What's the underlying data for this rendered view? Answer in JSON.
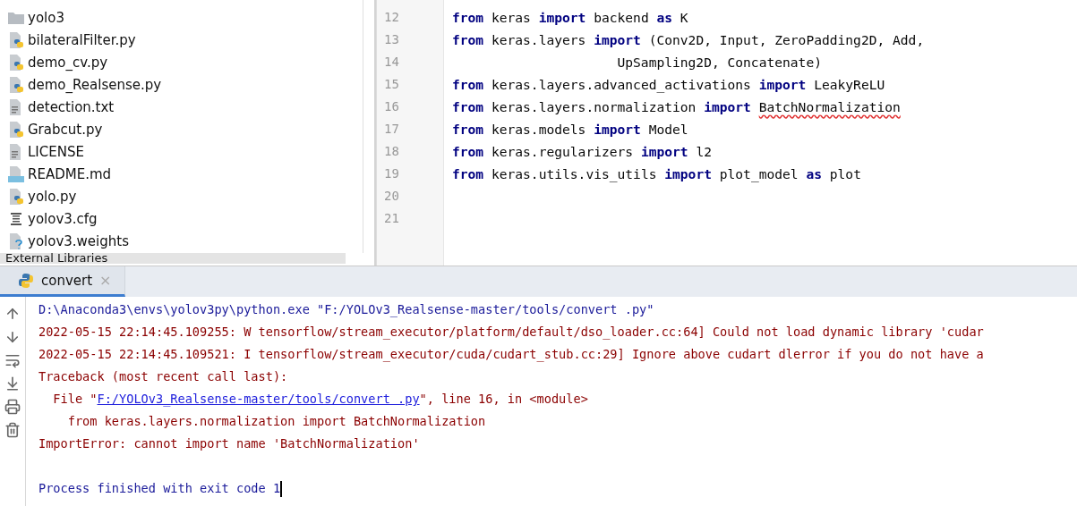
{
  "project_tree": {
    "items": [
      {
        "name": "yolo3",
        "kind": "folder"
      },
      {
        "name": "bilateralFilter.py",
        "kind": "python"
      },
      {
        "name": "demo_cv.py",
        "kind": "python"
      },
      {
        "name": "demo_Realsense.py",
        "kind": "python"
      },
      {
        "name": "detection.txt",
        "kind": "text"
      },
      {
        "name": "Grabcut.py",
        "kind": "python"
      },
      {
        "name": "LICENSE",
        "kind": "text"
      },
      {
        "name": "README.md",
        "kind": "markdown"
      },
      {
        "name": "yolo.py",
        "kind": "python"
      },
      {
        "name": "yolov3.cfg",
        "kind": "config"
      },
      {
        "name": "yolov3.weights",
        "kind": "unknown"
      }
    ],
    "footer": "External Libraries"
  },
  "editor": {
    "lines": [
      {
        "number": "12",
        "tokens": [
          {
            "text": "from",
            "kind": "keyword"
          },
          {
            "text": " keras ",
            "kind": "plain"
          },
          {
            "text": "import",
            "kind": "keyword"
          },
          {
            "text": " backend ",
            "kind": "plain"
          },
          {
            "text": "as",
            "kind": "keyword"
          },
          {
            "text": " K",
            "kind": "plain"
          }
        ]
      },
      {
        "number": "13",
        "tokens": [
          {
            "text": "from",
            "kind": "keyword"
          },
          {
            "text": " keras.layers ",
            "kind": "plain"
          },
          {
            "text": "import",
            "kind": "keyword"
          },
          {
            "text": " (Conv2D, Input, ZeroPadding2D, Add,",
            "kind": "plain"
          }
        ]
      },
      {
        "number": "14",
        "tokens": [
          {
            "text": "                     UpSampling2D, Concatenate)",
            "kind": "plain"
          }
        ]
      },
      {
        "number": "15",
        "tokens": [
          {
            "text": "from",
            "kind": "keyword"
          },
          {
            "text": " keras.layers.advanced_activations ",
            "kind": "plain"
          },
          {
            "text": "import",
            "kind": "keyword"
          },
          {
            "text": " LeakyReLU",
            "kind": "plain"
          }
        ]
      },
      {
        "number": "16",
        "tokens": [
          {
            "text": "from",
            "kind": "keyword"
          },
          {
            "text": " keras.layers.normalization ",
            "kind": "plain"
          },
          {
            "text": "import",
            "kind": "keyword"
          },
          {
            "text": "BatchNormalization",
            "kind": "warning"
          }
        ]
      },
      {
        "number": "17",
        "tokens": [
          {
            "text": "from",
            "kind": "keyword"
          },
          {
            "text": " keras.models ",
            "kind": "plain"
          },
          {
            "text": "import",
            "kind": "keyword"
          },
          {
            "text": " Model",
            "kind": "plain"
          }
        ]
      },
      {
        "number": "18",
        "tokens": [
          {
            "text": "from",
            "kind": "keyword"
          },
          {
            "text": " keras.regularizers ",
            "kind": "plain"
          },
          {
            "text": "import",
            "kind": "keyword"
          },
          {
            "text": " l2",
            "kind": "plain"
          }
        ]
      },
      {
        "number": "19",
        "tokens": [
          {
            "text": "from",
            "kind": "keyword"
          },
          {
            "text": " keras.utils.vis_utils ",
            "kind": "plain"
          },
          {
            "text": "import",
            "kind": "keyword"
          },
          {
            "text": " plot_model ",
            "kind": "plain"
          },
          {
            "text": "as",
            "kind": "keyword"
          },
          {
            "text": " plot",
            "kind": "plain"
          }
        ]
      },
      {
        "number": "20"
      },
      {
        "number": "21"
      }
    ]
  },
  "run_panel": {
    "tabs": [
      {
        "label": "convert",
        "selected": true,
        "close": "×"
      }
    ],
    "console": [
      {
        "segments": [
          {
            "text": "D:\\Anaconda3\\envs\\yolov3py\\python.exe \"F:/YOLOv3_Realsense-master/tools/convert .py\"",
            "kind": "command"
          }
        ]
      },
      {
        "segments": [
          {
            "text": "2022-05-15 22:14:45.109255: W tensorflow/stream_executor/platform/default/dso_loader.cc:64] Could not load dynamic library 'cudar",
            "kind": "error"
          }
        ]
      },
      {
        "segments": [
          {
            "text": "2022-05-15 22:14:45.109521: I tensorflow/stream_executor/cuda/cudart_stub.cc:29] Ignore above cudart dlerror if you do not have a",
            "kind": "error"
          }
        ]
      },
      {
        "segments": [
          {
            "text": "Traceback (most recent call last):",
            "kind": "error"
          }
        ]
      },
      {
        "segments": [
          {
            "text": "  File \"",
            "kind": "error"
          },
          {
            "text": "F:/YOLOv3_Realsense-master/tools/convert .py",
            "kind": "link"
          },
          {
            "text": "\", line 16, in <module>",
            "kind": "error"
          }
        ]
      },
      {
        "segments": [
          {
            "text": "    from keras.layers.normalization import BatchNormalization",
            "kind": "error"
          }
        ]
      },
      {
        "segments": [
          {
            "text": "ImportError: cannot import name 'BatchNormalization'",
            "kind": "error"
          }
        ]
      },
      {
        "segments": [
          {
            "text": "Process finished with exit code 1",
            "kind": "command"
          }
        ],
        "cursor": true,
        "gap_before": true
      }
    ]
  }
}
